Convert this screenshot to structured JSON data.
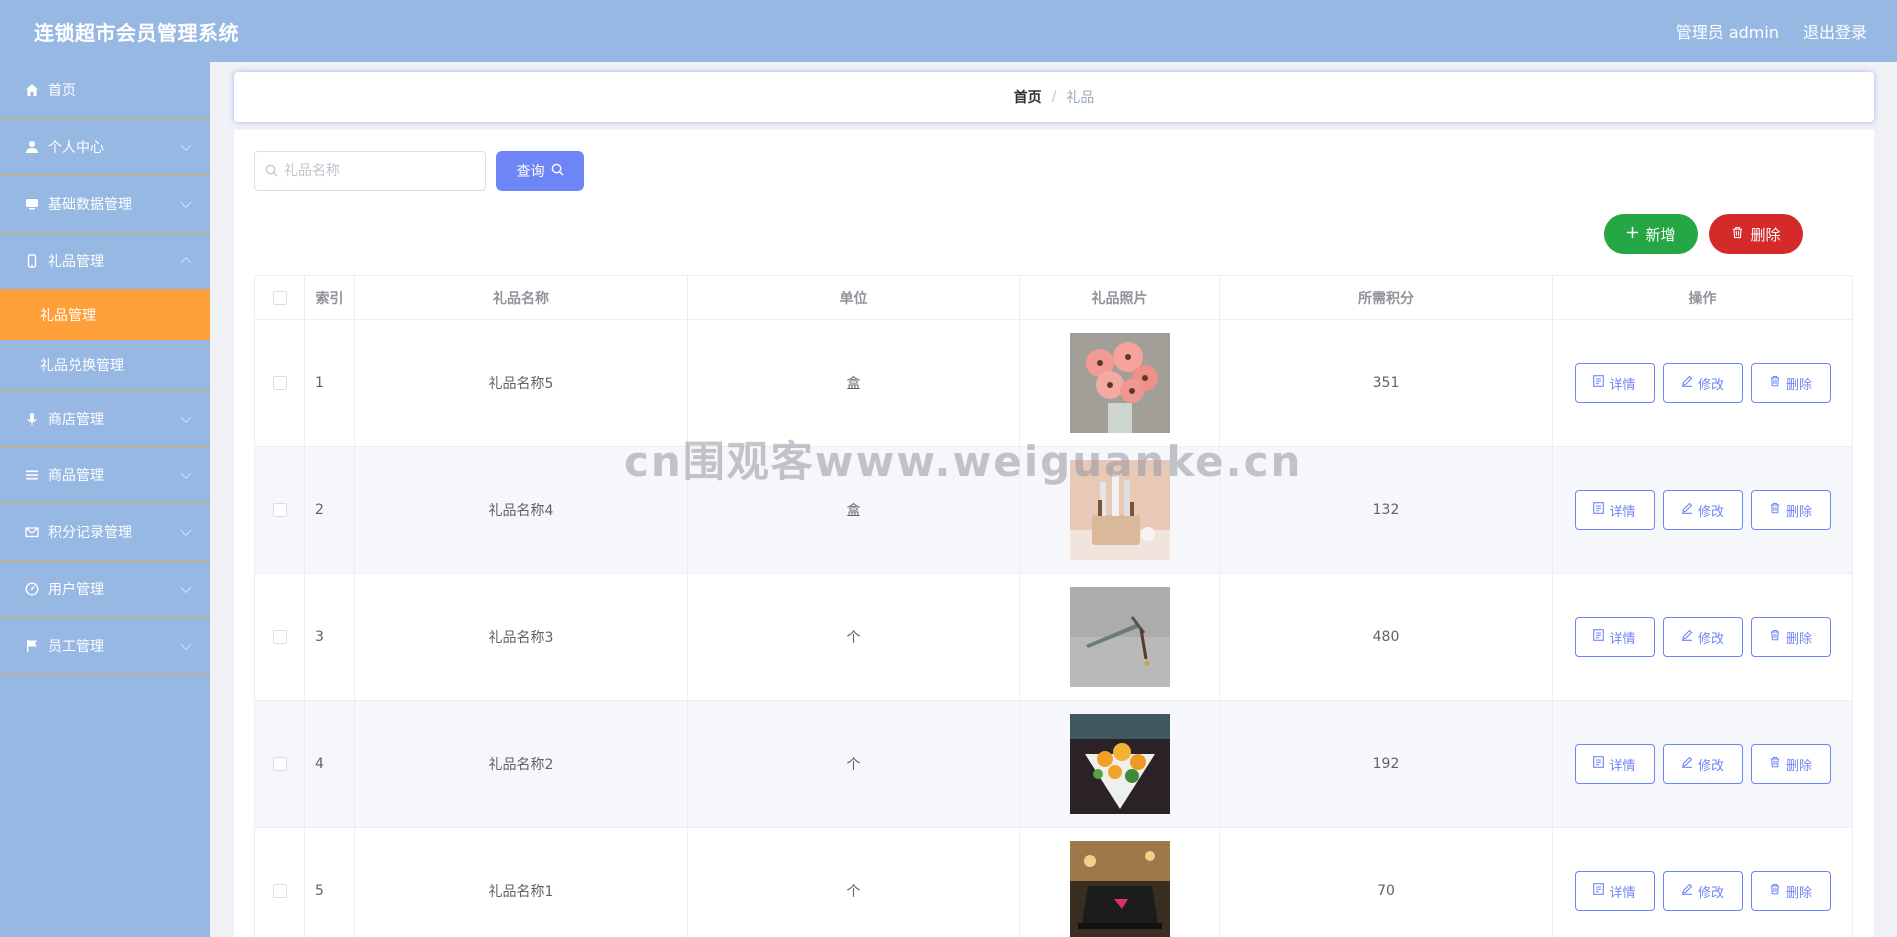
{
  "header": {
    "title": "连锁超市会员管理系统",
    "user": "管理员 admin",
    "logout": "退出登录"
  },
  "sidebar": {
    "items": [
      {
        "label": "首页",
        "icon": "home-icon"
      },
      {
        "label": "个人中心",
        "icon": "user-icon"
      },
      {
        "label": "基础数据管理",
        "icon": "monitor-icon"
      },
      {
        "label": "礼品管理",
        "icon": "phone-icon",
        "children": [
          "礼品管理",
          "礼品兑换管理"
        ]
      },
      {
        "label": "商店管理",
        "icon": "microphone-icon"
      },
      {
        "label": "商品管理",
        "icon": "menu-icon"
      },
      {
        "label": "积分记录管理",
        "icon": "message-icon"
      },
      {
        "label": "用户管理",
        "icon": "dashboard-icon"
      },
      {
        "label": "员工管理",
        "icon": "flag-icon"
      }
    ],
    "active_sub": "礼品管理"
  },
  "breadcrumb": {
    "home": "首页",
    "separator": "/",
    "current": "礼品"
  },
  "toolbar": {
    "search_placeholder": "礼品名称",
    "query_label": "查询",
    "add_label": "新增",
    "delete_label": "删除"
  },
  "table": {
    "columns": [
      "索引",
      "礼品名称",
      "单位",
      "礼品照片",
      "所需积分",
      "操作"
    ],
    "rows": [
      {
        "index": "1",
        "name": "礼品名称5",
        "unit": "盒",
        "photo": "pink-flowers",
        "points": "351"
      },
      {
        "index": "2",
        "name": "礼品名称4",
        "unit": "盒",
        "photo": "knife-set",
        "points": "132"
      },
      {
        "index": "3",
        "name": "礼品名称3",
        "unit": "个",
        "photo": "sword",
        "points": "480"
      },
      {
        "index": "4",
        "name": "礼品名称2",
        "unit": "个",
        "photo": "flower-bouquet",
        "points": "192"
      },
      {
        "index": "5",
        "name": "礼品名称1",
        "unit": "个",
        "photo": "laptop",
        "points": "70"
      }
    ],
    "actions": {
      "detail": "详情",
      "edit": "修改",
      "delete": "删除"
    }
  },
  "watermark": "cn围观客www.weiguanke.cn",
  "colors": {
    "header_bg": "#96b8e3",
    "sidebar_bg": "#96b8e3",
    "active_item": "#ff9f3a",
    "primary": "#6e85f5",
    "success": "#24a744",
    "danger": "#d52a2a"
  }
}
